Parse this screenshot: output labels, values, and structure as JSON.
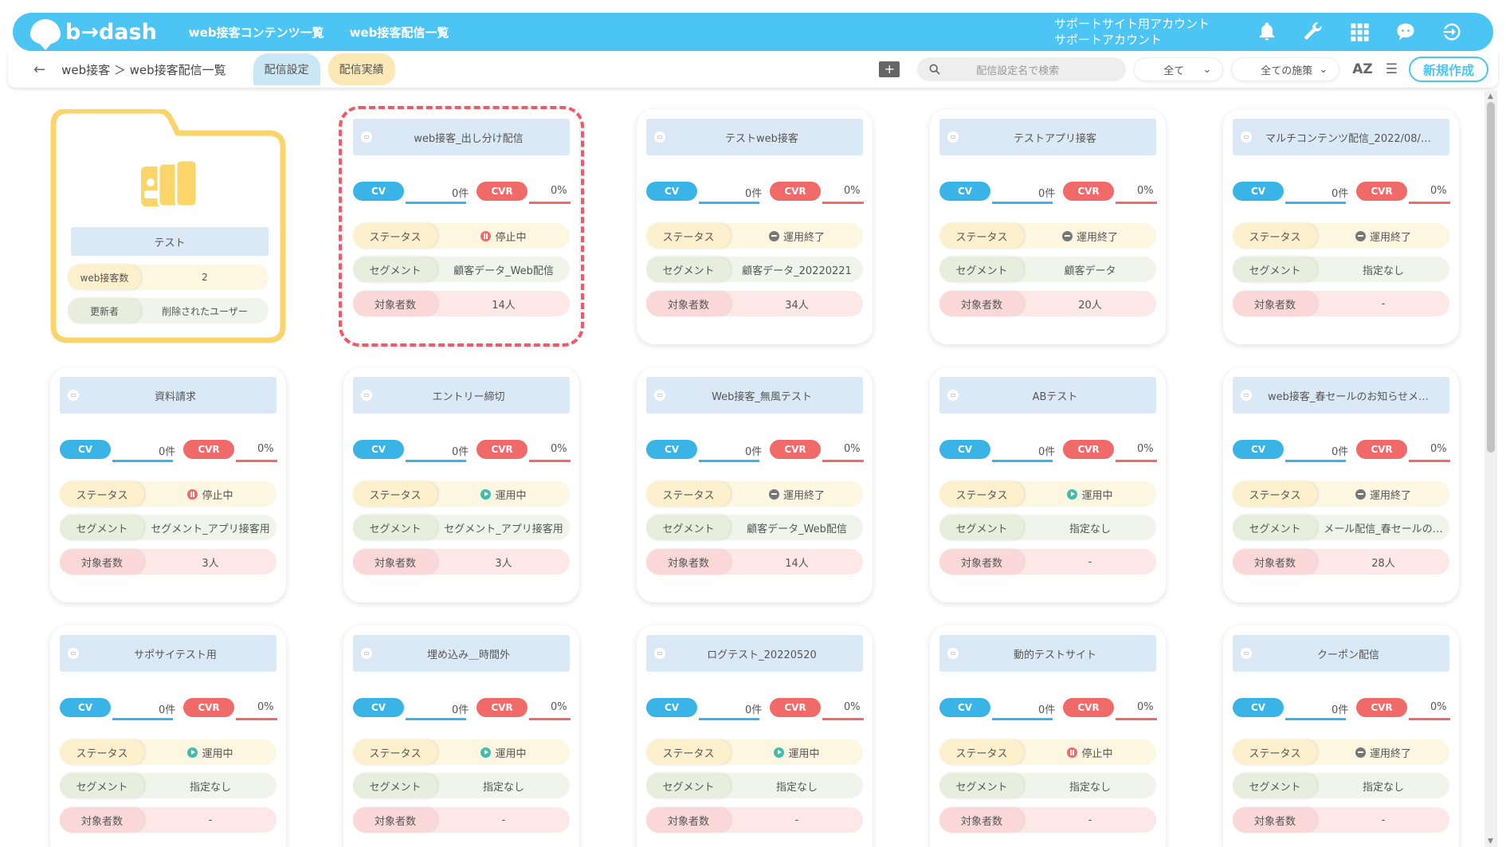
{
  "header": {
    "logo_text": "b→dash",
    "nav": [
      "web接客コンテンツ一覧",
      "web接客配信一覧"
    ],
    "account_line1": "サポートサイト用アカウント",
    "account_line2": "サポートアカウント",
    "icons": [
      "bell-icon",
      "wrench-icon",
      "apps-grid-icon",
      "chat-bot-icon",
      "logout-icon"
    ]
  },
  "subbar": {
    "back": "←",
    "breadcrumb": "web接客 ＞ web接客配信一覧",
    "tabs": [
      "配信設定",
      "配信実績"
    ],
    "search_placeholder": "配信設定名で検索",
    "filter1": "全て",
    "filter2": "全ての施策",
    "sort_label": "AZ",
    "new_button": "新規作成"
  },
  "labels": {
    "cv": "CV",
    "cvr": "CVR",
    "status": "ステータス",
    "segment": "セグメント",
    "target": "対象者数"
  },
  "folder": {
    "name": "テスト",
    "count_label": "web接客数",
    "count": "2",
    "updater_label": "更新者",
    "updater": "削除されたユーザー"
  },
  "cards": [
    {
      "title": "web接客_出し分け配信",
      "cv": "0件",
      "cvr": "0%",
      "status": "停止中",
      "status_type": "stop",
      "segment": "顧客データ_Web配信",
      "target": "14人"
    },
    {
      "title": "テストweb接客",
      "cv": "0件",
      "cvr": "0%",
      "status": "運用終了",
      "status_type": "end",
      "segment": "顧客データ_20220221",
      "target": "34人"
    },
    {
      "title": "テストアプリ接客",
      "cv": "0件",
      "cvr": "0%",
      "status": "運用終了",
      "status_type": "end",
      "segment": "顧客データ",
      "target": "20人"
    },
    {
      "title": "マルチコンテンツ配信_2022/08/…",
      "cv": "0件",
      "cvr": "0%",
      "status": "運用終了",
      "status_type": "end",
      "segment": "指定なし",
      "target": "-"
    },
    {
      "title": "資料請求",
      "cv": "0件",
      "cvr": "0%",
      "status": "停止中",
      "status_type": "stop",
      "segment": "セグメント_アプリ接客用",
      "target": "3人"
    },
    {
      "title": "エントリー締切",
      "cv": "0件",
      "cvr": "0%",
      "status": "運用中",
      "status_type": "run",
      "segment": "セグメント_アプリ接客用",
      "target": "3人"
    },
    {
      "title": "Web接客_無風テスト",
      "cv": "0件",
      "cvr": "0%",
      "status": "運用終了",
      "status_type": "end",
      "segment": "顧客データ_Web配信",
      "target": "14人"
    },
    {
      "title": "ABテスト",
      "cv": "0件",
      "cvr": "0%",
      "status": "運用中",
      "status_type": "run",
      "segment": "指定なし",
      "target": "-"
    },
    {
      "title": "web接客_春セールのお知らせメ…",
      "cv": "0件",
      "cvr": "0%",
      "status": "運用終了",
      "status_type": "end",
      "segment": "メール配信_春セールの…",
      "target": "28人"
    },
    {
      "title": "サポサイテスト用",
      "cv": "0件",
      "cvr": "0%",
      "status": "運用中",
      "status_type": "run",
      "segment": "指定なし",
      "target": "-"
    },
    {
      "title": "埋め込み＿時間外",
      "cv": "0件",
      "cvr": "0%",
      "status": "運用中",
      "status_type": "run",
      "segment": "指定なし",
      "target": "-"
    },
    {
      "title": "ログテスト_20220520",
      "cv": "0件",
      "cvr": "0%",
      "status": "運用中",
      "status_type": "run",
      "segment": "指定なし",
      "target": "-"
    },
    {
      "title": "動的テストサイト",
      "cv": "0件",
      "cvr": "0%",
      "status": "停止中",
      "status_type": "stop",
      "segment": "指定なし",
      "target": "-"
    },
    {
      "title": "クーポン配信",
      "cv": "0件",
      "cvr": "0%",
      "status": "運用終了",
      "status_type": "end",
      "segment": "指定なし",
      "target": "-"
    }
  ],
  "colors": {
    "accent": "#4cc5f5",
    "cv": "#3ab4e6",
    "cvr": "#f06a6a",
    "folder": "#fbd46a",
    "highlight": "#ef5a6a"
  }
}
